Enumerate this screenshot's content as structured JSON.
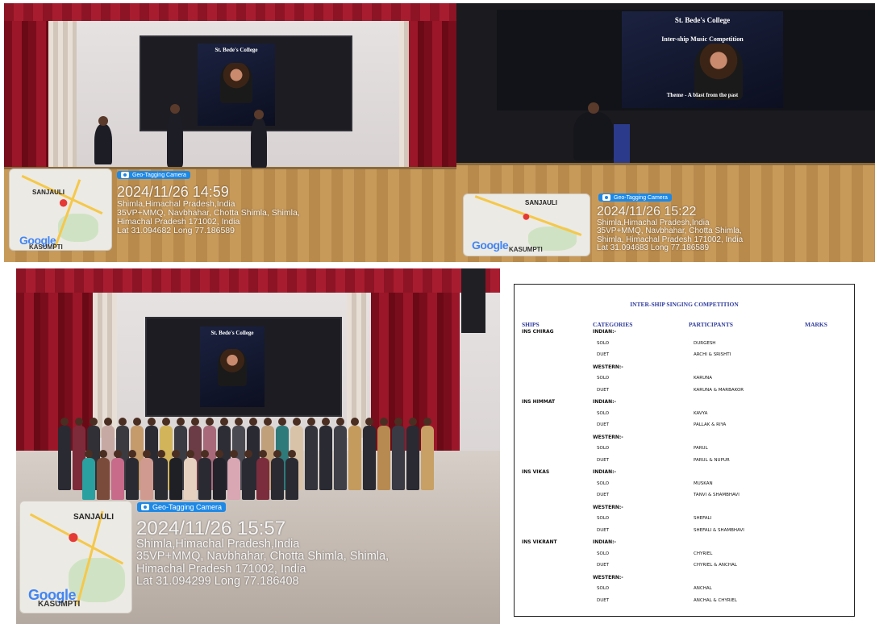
{
  "photos": [
    {
      "id": "photo1",
      "map_place": "SANJAULI",
      "map_place2": "KASUMPTI",
      "map_logo": "Google",
      "tag_label": "Geo-Tagging Camera",
      "datetime": "2024/11/26 14:59",
      "lines": [
        "Shimla,Himachal Pradesh,India",
        "35VP+MMQ, Navbhahar, Chotta Shimla, Shimla,",
        "Himachal Pradesh 171002, India",
        "Lat 31.094682 Long 77.186589"
      ]
    },
    {
      "id": "photo2",
      "map_place": "SANJAULI",
      "map_place2": "KASUMPTI",
      "map_logo": "Google",
      "tag_label": "Geo-Tagging Camera",
      "datetime": "2024/11/26 15:22",
      "lines": [
        "Shimla,Himachal Pradesh,India",
        "35VP+MMQ, Navbhahar, Chotta Shimla,",
        "Shimla, Himachal Pradesh 171002, India",
        "Lat 31.094683 Long 77.186589"
      ]
    },
    {
      "id": "photo3",
      "map_place": "SANJAULI",
      "map_place2": "KASUMPTI",
      "map_logo": "Google",
      "tag_label": "Geo-Tagging Camera",
      "datetime": "2024/11/26 15:57",
      "lines": [
        "Shimla,Himachal Pradesh,India",
        "35VP+MMQ, Navbhahar, Chotta Shimla, Shimla,",
        "Himachal Pradesh 171002, India",
        "Lat 31.094299 Long 77.186408"
      ]
    }
  ],
  "poster": {
    "college": "St. Bede's College",
    "event": "Inter-ship Music Competition",
    "theme": "Theme - A blast from the past"
  },
  "doc": {
    "title": "INTER-SHIP SINGING COMPETITION",
    "headers": [
      "SHIPS",
      "CATEGORIES",
      "PARTICIPANTS",
      "MARKS"
    ],
    "ships": [
      {
        "name": "INS CHIRAG",
        "groups": [
          {
            "label": "INDIAN:-",
            "rows": [
              {
                "cat": "SOLO",
                "part": "DURGESH"
              },
              {
                "cat": "DUET",
                "part": "ARCHI & SRISHTI"
              }
            ]
          },
          {
            "label": "WESTERN:-",
            "rows": [
              {
                "cat": "SOLO",
                "part": "KARUNA"
              },
              {
                "cat": "DUET",
                "part": "KARUNA & MARBAKOR"
              }
            ]
          }
        ]
      },
      {
        "name": "INS HIMMAT",
        "groups": [
          {
            "label": "INDIAN:-",
            "rows": [
              {
                "cat": "SOLO",
                "part": "KAVYA"
              },
              {
                "cat": "DUET",
                "part": "PALLAK & RIYA"
              }
            ]
          },
          {
            "label": "WESTERN:-",
            "rows": [
              {
                "cat": "SOLO",
                "part": "PARUL"
              },
              {
                "cat": "DUET",
                "part": "PARUL & NUPUR"
              }
            ]
          }
        ]
      },
      {
        "name": "INS VIKAS",
        "groups": [
          {
            "label": "INDIAN:-",
            "rows": [
              {
                "cat": "SOLO",
                "part": "MUSKAN"
              },
              {
                "cat": "DUET",
                "part": "TANVI & SHAMBHAVI"
              }
            ]
          },
          {
            "label": "WESTERN:-",
            "rows": [
              {
                "cat": "SOLO",
                "part": "SHEFALI"
              },
              {
                "cat": "DUET",
                "part": "SHEFALI & SHAMBHAVI"
              }
            ]
          }
        ]
      },
      {
        "name": "INS VIKRANT",
        "groups": [
          {
            "label": "INDIAN:-",
            "rows": [
              {
                "cat": "SOLO",
                "part": "CHYRIEL"
              },
              {
                "cat": "DUET",
                "part": "CHYRIEL & ANCHAL"
              }
            ]
          },
          {
            "label": "WESTERN:-",
            "rows": [
              {
                "cat": "SOLO",
                "part": "ANCHAL"
              },
              {
                "cat": "DUET",
                "part": "ANCHAL & CHYRIEL"
              }
            ]
          }
        ]
      }
    ]
  }
}
